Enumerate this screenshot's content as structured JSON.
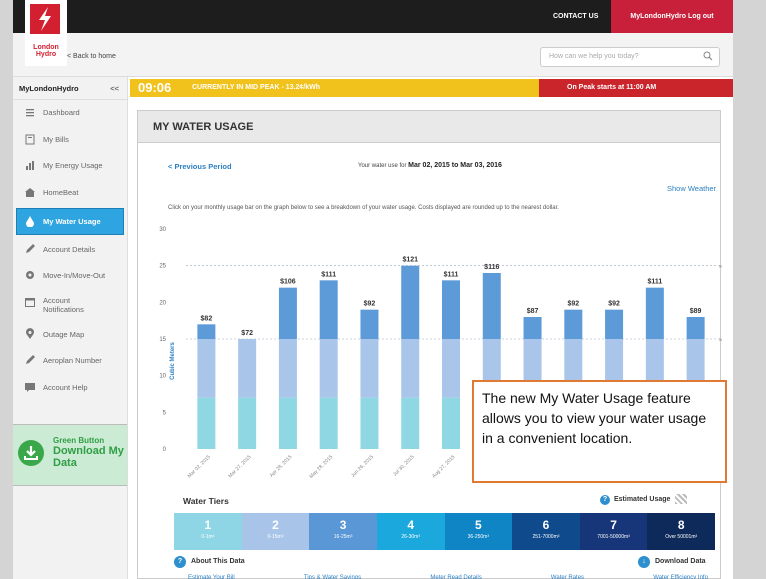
{
  "topbar": {
    "logo_text": "London Hydro",
    "contact_label": "CONTACT US",
    "account_label": "MyLondonHydro Log out"
  },
  "subbar": {
    "back_label": "< Back to home",
    "search_placeholder": "How can we help you today?"
  },
  "sidebar": {
    "title": "MyLondonHydro",
    "collapse_label": "<<",
    "items": [
      {
        "label": "Dashboard",
        "icon": "list-icon"
      },
      {
        "label": "My Bills",
        "icon": "bill-icon"
      },
      {
        "label": "My Energy Usage",
        "icon": "bars-icon"
      },
      {
        "label": "HomeBeat",
        "icon": "house-icon"
      },
      {
        "label": "My Water Usage",
        "icon": "drop-icon",
        "active": true
      },
      {
        "label": "Account Details",
        "icon": "pencil-icon"
      },
      {
        "label": "Move-In/Move-Out",
        "icon": "gear-icon"
      },
      {
        "label": "Account Notifications",
        "icon": "calendar-icon"
      },
      {
        "label": "Outage Map",
        "icon": "pin-icon"
      },
      {
        "label": "Aeroplan Number",
        "icon": "pencil-icon"
      },
      {
        "label": "Account Help",
        "icon": "chat-icon"
      }
    ],
    "green_button": {
      "small": "Green Button",
      "big": "Download My Data"
    }
  },
  "peak": {
    "time": "09:06",
    "current": "CURRENTLY IN MID PEAK - 13.2¢/kWh",
    "next": "On Peak starts at 11:00 AM"
  },
  "panel": {
    "title": "MY WATER USAGE",
    "prev_label": "< Previous Period",
    "range_prefix": "Your water use for",
    "range_value": "Mar 02, 2015 to Mar 03, 2016",
    "weather_label": "Show Weather",
    "instructions": "Click on your monthly usage bar on the graph below to see a breakdown of your water usage. Costs displayed are rounded up to the nearest dollar."
  },
  "chart_data": {
    "type": "bar",
    "ylabel": "Cubic Meters",
    "ylim": [
      0,
      30
    ],
    "yticks": [
      0,
      5,
      10,
      15,
      20,
      25,
      30
    ],
    "tier_lines": [
      {
        "value": 25,
        "label": "Tier 3"
      },
      {
        "value": 15,
        "label": "Tier 2"
      }
    ],
    "categories": [
      "Mar 02, 2015",
      "Mar 27, 2015",
      "Apr 28, 2015",
      "May 28, 2015",
      "Jun 26, 2015",
      "Jul 30, 2015",
      "Aug 27, 2015",
      "Sep 28, 2015",
      "Oct 28, 2015",
      "Nov 26, 2015",
      "Dec 29, 2015",
      "Jan 28, 2016",
      "Mar 03, 2016"
    ],
    "values": [
      17,
      15,
      22,
      23,
      19,
      25,
      23,
      24,
      18,
      19,
      19,
      22,
      18
    ],
    "costs": [
      "$82",
      "$72",
      "$106",
      "$111",
      "$92",
      "$121",
      "$111",
      "$116",
      "$87",
      "$92",
      "$92",
      "$111",
      "$89"
    ],
    "tier_colors": [
      "#8fd7e3",
      "#a9c6ea",
      "#5c9ad8"
    ]
  },
  "tiers": {
    "title": "Water Tiers",
    "estimated_label": "Estimated Usage",
    "items": [
      {
        "n": "1",
        "r": "0-1m³",
        "color": "#8ed5e6"
      },
      {
        "n": "2",
        "r": "0-15m³",
        "color": "#a8c5e9"
      },
      {
        "n": "3",
        "r": "16-25m³",
        "color": "#5a97d6"
      },
      {
        "n": "4",
        "r": "26-30m³",
        "color": "#1ba8dc"
      },
      {
        "n": "5",
        "r": "36-250m³",
        "color": "#0f85c6"
      },
      {
        "n": "6",
        "r": "251-7000m³",
        "color": "#0f4a8c"
      },
      {
        "n": "7",
        "r": "7001-50000m³",
        "color": "#163679"
      },
      {
        "n": "8",
        "r": "Over 50001m³",
        "color": "#0d2a5a"
      }
    ],
    "about_label": "About This Data",
    "download_label": "Download Data",
    "footer_links": [
      "Estimate Your Bill",
      "Tips & Water Savings",
      "Meter Read Details",
      "Water Rates",
      "Water Efficiency Info"
    ]
  },
  "callout": {
    "text": "The new My Water Usage feature allows you to view your water usage in a convenient location.",
    "border_color": "#e07a32"
  }
}
